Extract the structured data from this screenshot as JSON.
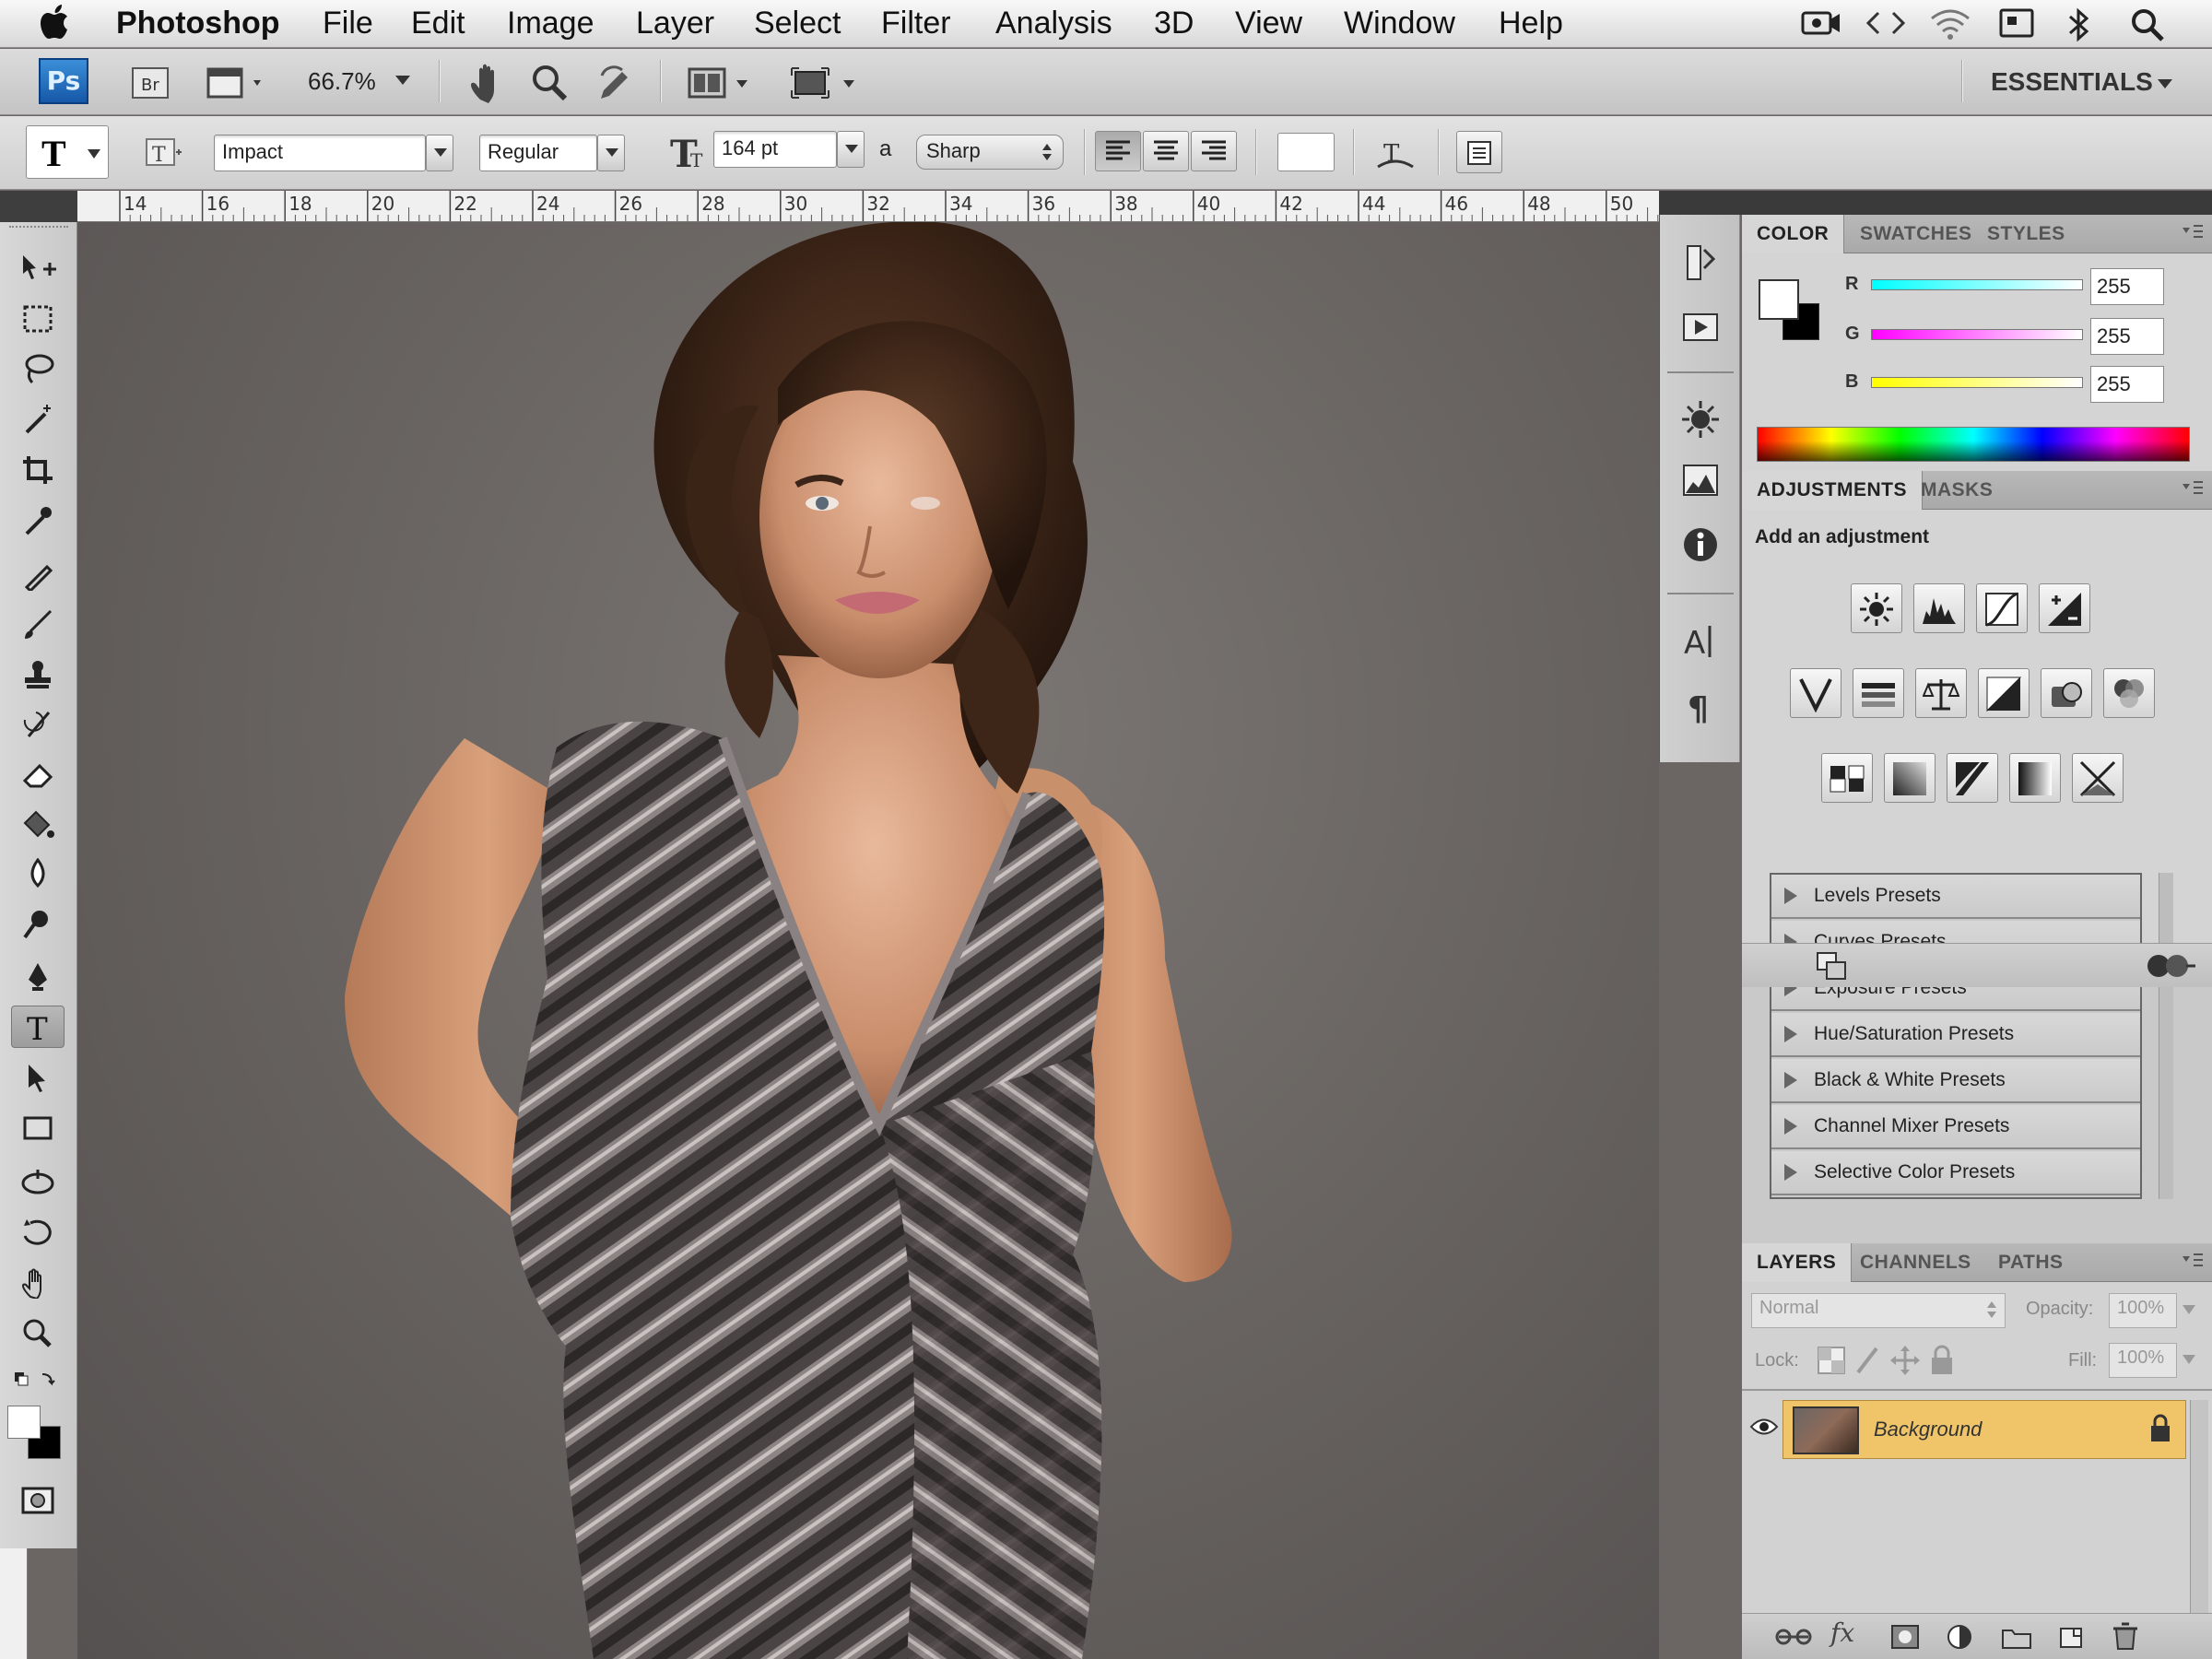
{
  "menubar": {
    "app_name": "Photoshop",
    "items": [
      "File",
      "Edit",
      "Image",
      "Layer",
      "Select",
      "Filter",
      "Analysis",
      "3D",
      "View",
      "Window",
      "Help"
    ]
  },
  "appbar": {
    "ps_logo": "Ps",
    "zoom": "66.7%",
    "workspace": "ESSENTIALS"
  },
  "options": {
    "tool_glyph": "T",
    "font_family": "Impact",
    "font_style": "Regular",
    "font_size": "164 pt",
    "aa_label": "a",
    "antialias": "Sharp"
  },
  "ruler": {
    "ticks": [
      "14",
      "16",
      "18",
      "20",
      "22",
      "24",
      "26",
      "28",
      "30",
      "32",
      "34",
      "36",
      "38",
      "40",
      "42",
      "44",
      "46",
      "48",
      "50"
    ]
  },
  "color_panel": {
    "tabs": [
      "COLOR",
      "SWATCHES",
      "STYLES"
    ],
    "channels": [
      {
        "label": "R",
        "value": "255"
      },
      {
        "label": "G",
        "value": "255"
      },
      {
        "label": "B",
        "value": "255"
      }
    ]
  },
  "adjustments_panel": {
    "tabs": [
      "ADJUSTMENTS",
      "MASKS"
    ],
    "heading": "Add an adjustment",
    "presets": [
      "Levels Presets",
      "Curves Presets",
      "Exposure Presets",
      "Hue/Saturation Presets",
      "Black & White Presets",
      "Channel Mixer Presets",
      "Selective Color Presets"
    ]
  },
  "layers_panel": {
    "tabs": [
      "LAYERS",
      "CHANNELS",
      "PATHS"
    ],
    "blend_mode": "Normal",
    "opacity_label": "Opacity:",
    "opacity_value": "100%",
    "lock_label": "Lock:",
    "fill_label": "Fill:",
    "fill_value": "100%",
    "layers": [
      {
        "name": "Background"
      }
    ]
  },
  "colors": {
    "selected_layer": "#f0c56a",
    "canvas_bg": "#6d6866"
  }
}
